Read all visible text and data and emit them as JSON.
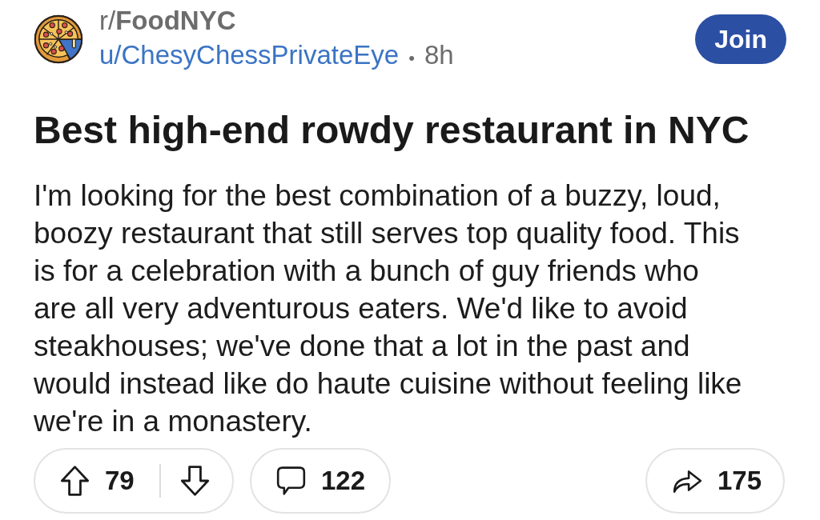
{
  "post": {
    "subreddit": "r/**FoodNYC**",
    "author": "u/ChesyChessPrivateEye",
    "separator": "•",
    "age": "8h",
    "join_button": "Join",
    "title": "Best high-end rowdy restaurant in NYC",
    "body": "I'm looking for the best combination of a buzzy, loud, boozy restaurant that still serves top quality food. This is for a celebration with a bunch of guy friends who are all very adventurous eaters. We'd like to avoid steakhouses; we've done that a lot in the past and would instead like do haute cuisine without feeling like we're in a monastery."
  },
  "actions": {
    "upvotes": "79",
    "comments": "122",
    "shares": "175"
  }
}
